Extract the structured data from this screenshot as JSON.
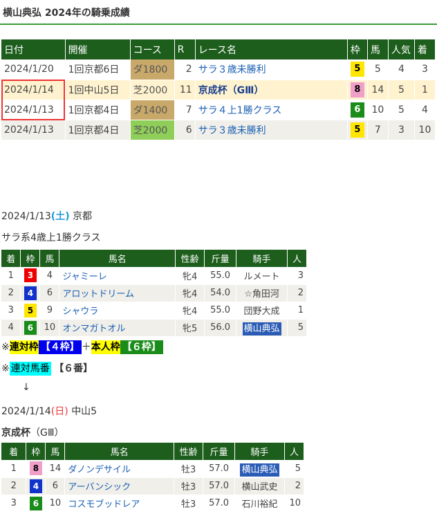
{
  "page_title": "横山典弘 2024年の騎乗成績",
  "history": {
    "headers": [
      "日付",
      "開催",
      "コース",
      "R",
      "レース名",
      "枠",
      "馬",
      "人気",
      "着"
    ],
    "rows": [
      {
        "date": "2024/1/20",
        "kaisai": "1回京都6日",
        "course": "ダ1800",
        "r": "2",
        "race": "サラ３歳未勝利",
        "waku": "5",
        "uma": "5",
        "ninki": "4",
        "chaku": "3"
      },
      {
        "date": "2024/1/14",
        "kaisai": "1回中山5日",
        "course": "芝2000",
        "r": "11",
        "race": "京成杯（GⅢ）",
        "waku": "8",
        "uma": "14",
        "ninki": "5",
        "chaku": "1"
      },
      {
        "date": "2024/1/13",
        "kaisai": "1回京都4日",
        "course": "ダ1400",
        "r": "7",
        "race": "サラ４上1勝クラス",
        "waku": "6",
        "uma": "10",
        "ninki": "5",
        "chaku": "4"
      },
      {
        "date": "2024/1/13",
        "kaisai": "1回京都4日",
        "course": "芝2000",
        "r": "6",
        "race": "サラ３歳未勝利",
        "waku": "5",
        "uma": "7",
        "ninki": "3",
        "chaku": "10"
      }
    ]
  },
  "race1": {
    "date": "2024/1/13",
    "dow": "(土)",
    "place": "京都",
    "name": "サラ系4歳上1勝クラス",
    "headers": [
      "着",
      "枠",
      "馬",
      "馬名",
      "性齢",
      "斤量",
      "騎手",
      "人"
    ],
    "rows": [
      {
        "chaku": "1",
        "waku": "3",
        "uma": "4",
        "horse": "ジャミーレ",
        "sexage": "牝4",
        "kin": "55.0",
        "jockey": "ルメート",
        "ninki": "3"
      },
      {
        "chaku": "2",
        "waku": "4",
        "uma": "6",
        "horse": "アロットドリーム",
        "sexage": "牝4",
        "kin": "54.0",
        "jockey": "☆角田河",
        "ninki": "2"
      },
      {
        "chaku": "3",
        "waku": "5",
        "uma": "9",
        "horse": "シャウラ",
        "sexage": "牝4",
        "kin": "55.0",
        "jockey": "団野大成",
        "ninki": "1"
      },
      {
        "chaku": "4",
        "waku": "6",
        "uma": "10",
        "horse": "オンマガトオル",
        "sexage": "牝5",
        "kin": "56.0",
        "jockey": "横山典弘",
        "ninki": "5"
      }
    ],
    "note1_prefix": "※",
    "note1_a": "連対枠",
    "note1_b": "【４枠】",
    "note1_plus": "＋",
    "note1_c": "本人枠",
    "note1_d": "【６枠】",
    "note2_prefix": "※",
    "note2_a": "連対馬番",
    "note2_b": "【６番】",
    "arrow": "↓"
  },
  "race2": {
    "date": "2024/1/14",
    "dow": "(日)",
    "place": "中山5",
    "name_bold": "京成杯",
    "name_rest": "（GⅢ）",
    "headers": [
      "着",
      "枠",
      "馬",
      "馬名",
      "性齢",
      "斤量",
      "騎手",
      "人"
    ],
    "rows": [
      {
        "chaku": "1",
        "waku": "8",
        "uma": "14",
        "horse": "ダノンデサイル",
        "sexage": "牡3",
        "kin": "57.0",
        "jockey": "横山典弘",
        "ninki": "5"
      },
      {
        "chaku": "2",
        "waku": "4",
        "uma": "6",
        "horse": "アーバンシック",
        "sexage": "牡3",
        "kin": "57.0",
        "jockey": "横山武史",
        "ninki": "2"
      },
      {
        "chaku": "3",
        "waku": "6",
        "uma": "10",
        "horse": "コスモブッドレア",
        "sexage": "牡3",
        "kin": "57.0",
        "jockey": "石川裕紀",
        "ninki": "10"
      }
    ]
  }
}
